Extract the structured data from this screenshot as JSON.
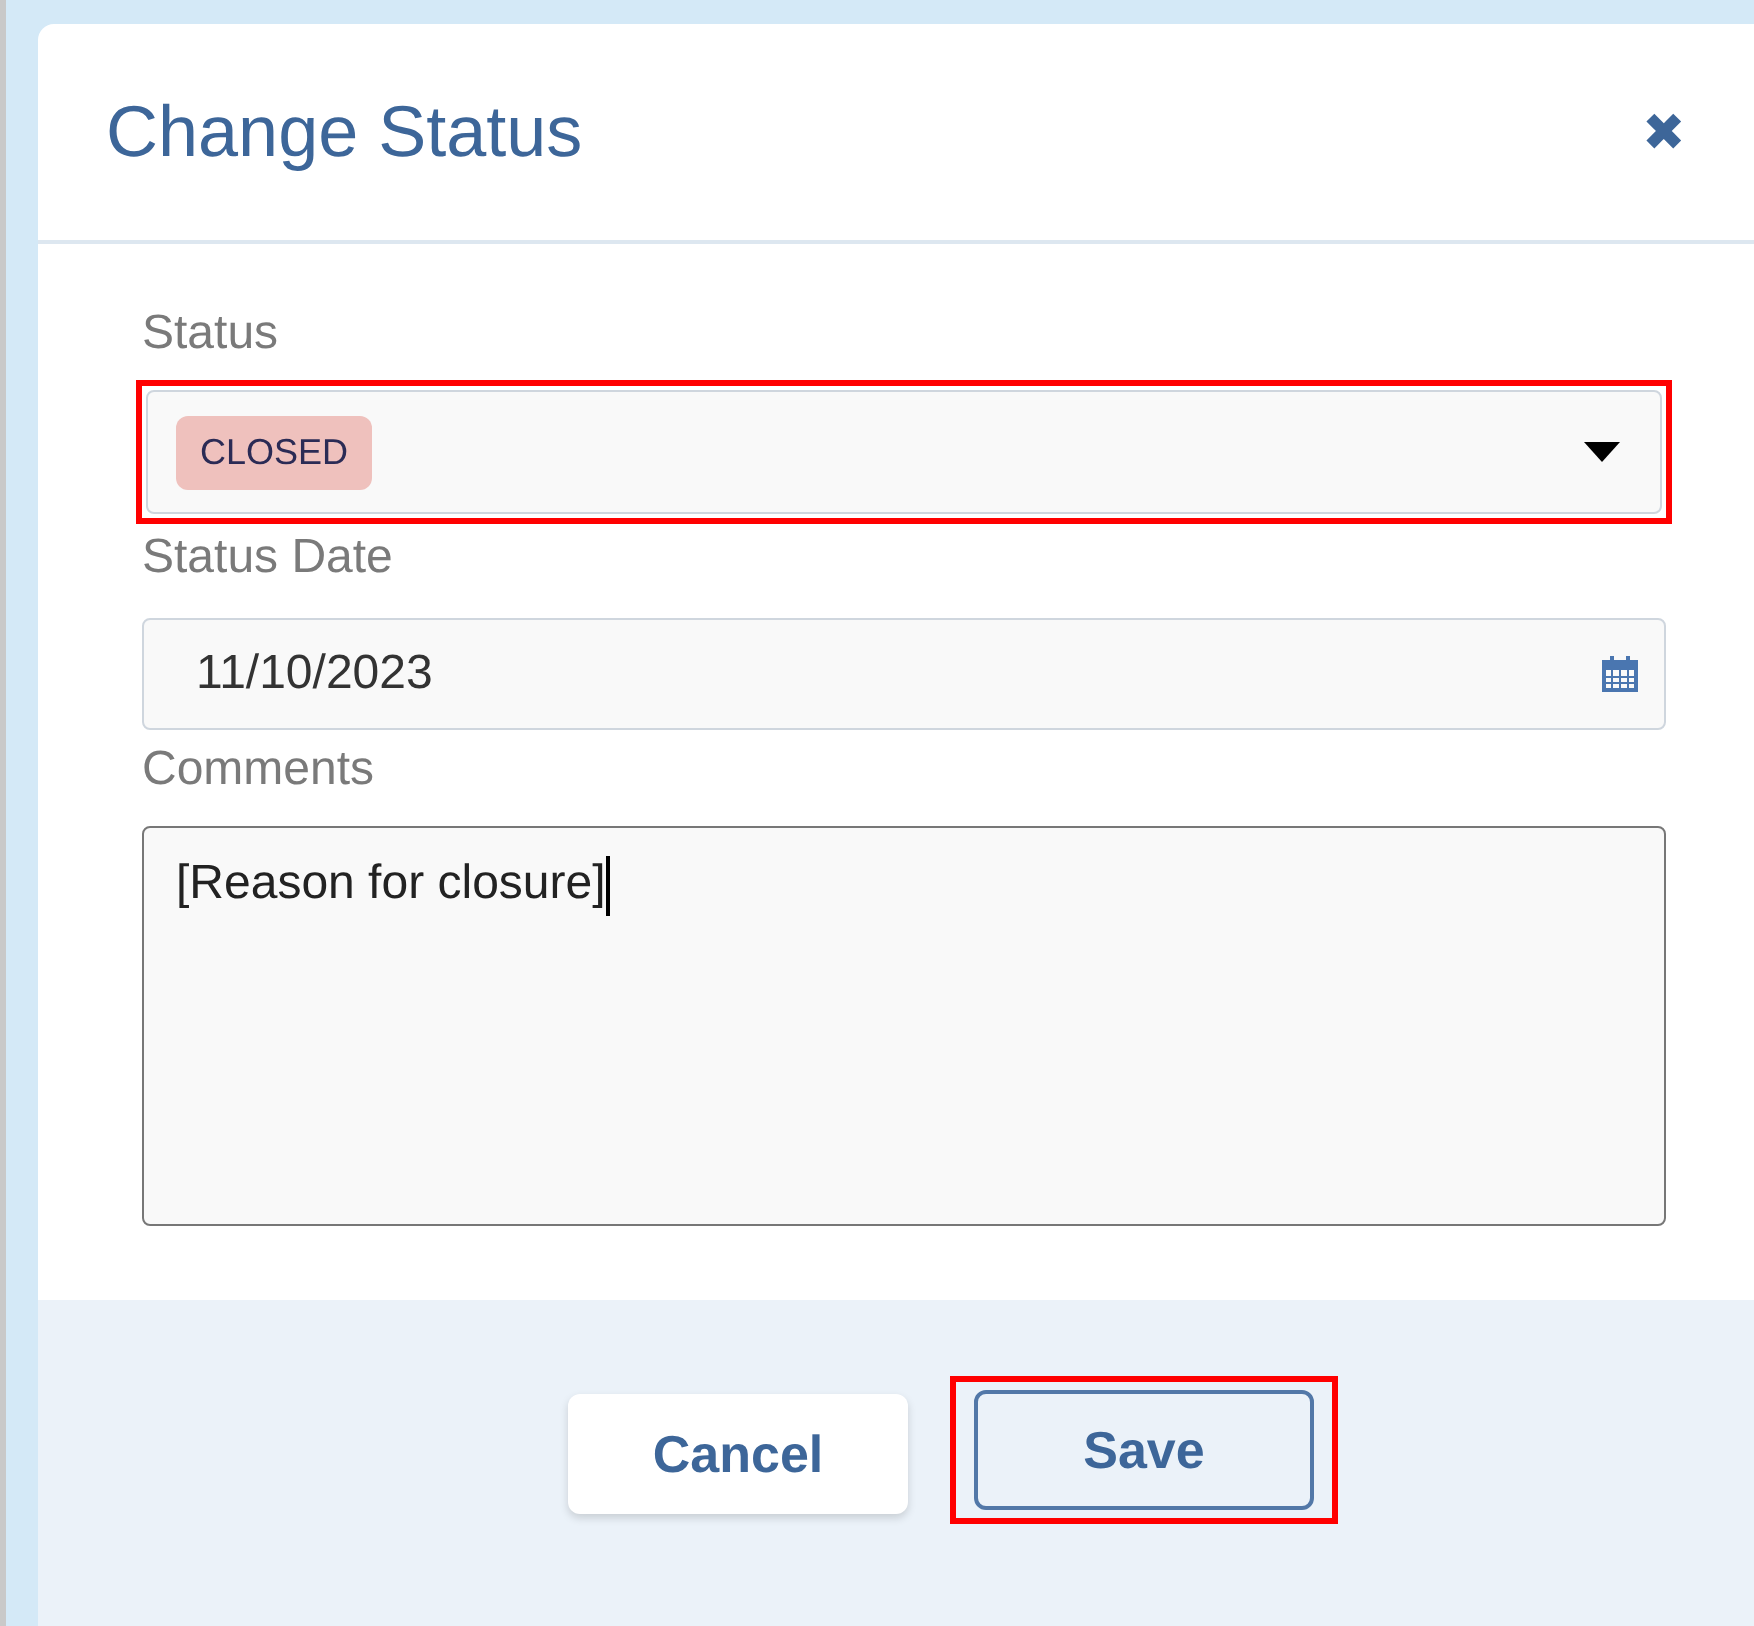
{
  "dialog": {
    "title": "Change Status",
    "close": "✖"
  },
  "fields": [
    {
      "kind": "select",
      "label": "Status",
      "value": "CLOSED",
      "highlighted": true
    },
    {
      "kind": "date",
      "label": "Status Date",
      "value": "11/10/2023",
      "highlighted": false
    },
    {
      "kind": "textarea",
      "label": "Comments",
      "value": "[Reason for closure]",
      "highlighted": false
    }
  ],
  "buttons": [
    {
      "label": "Cancel",
      "kind": "secondary",
      "highlighted": false
    },
    {
      "label": "Save",
      "kind": "primary",
      "highlighted": true
    }
  ]
}
